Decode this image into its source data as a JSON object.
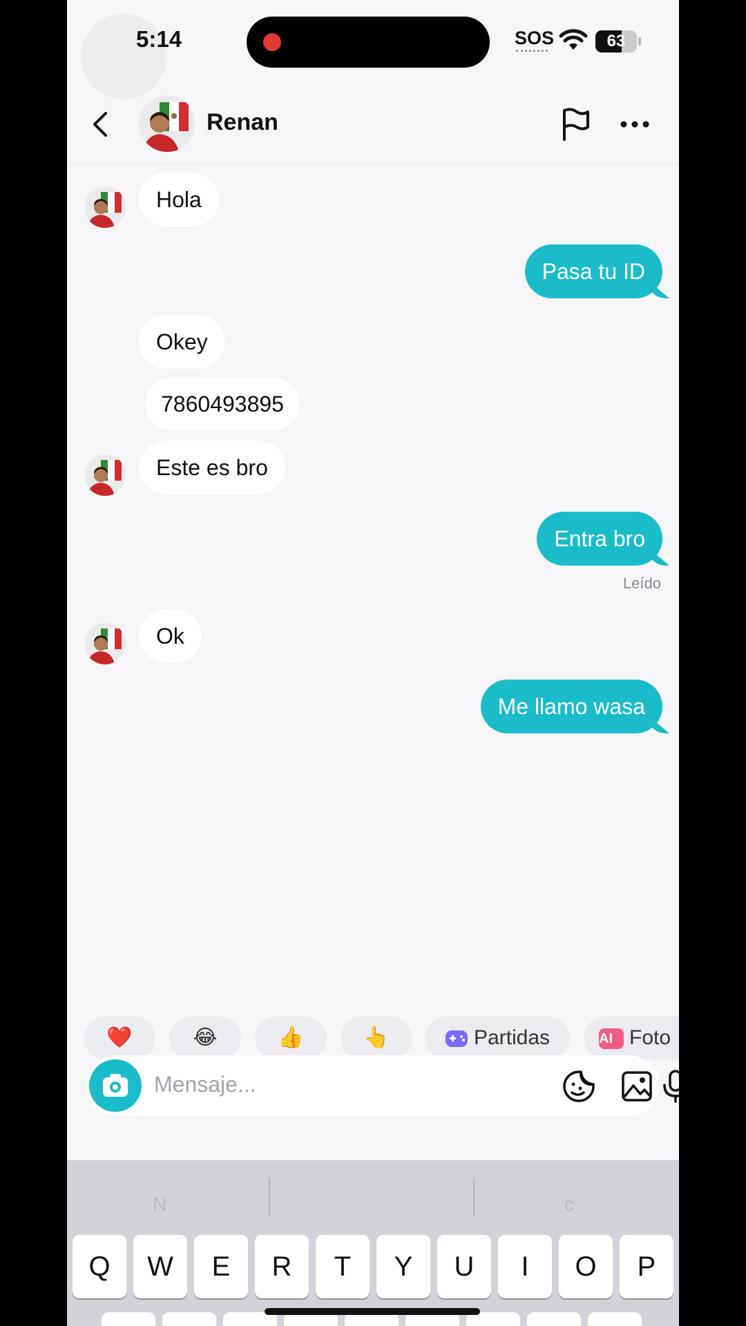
{
  "status": {
    "time": "5:14",
    "sos": "SOS",
    "battery": "63",
    "battery_level": 0.63
  },
  "header": {
    "contact_name": "Renan"
  },
  "messages": [
    {
      "from": "contact",
      "text": "Hola"
    },
    {
      "from": "me",
      "text": "Pasa tu ID"
    },
    {
      "from": "contact",
      "text": "Okey"
    },
    {
      "from": "contact",
      "text": "7860493895"
    },
    {
      "from": "contact",
      "text": "Este es bro"
    },
    {
      "from": "me",
      "text": "Entra bro"
    },
    {
      "from": "contact",
      "text": "Ok"
    },
    {
      "from": "me",
      "text": "Me llamo wasa"
    }
  ],
  "read_status": "Leído",
  "quick_replies": {
    "heart": "❤️",
    "laugh": "😂",
    "thumbs_up": "👍",
    "point": "👆",
    "games_label": "Partidas",
    "ai_badge": "AI",
    "photo_label": "Foto"
  },
  "composer": {
    "placeholder": "Mensaje..."
  },
  "keyboard": {
    "suggestion_1": "N",
    "suggestion_3": "c",
    "row1": [
      "Q",
      "W",
      "E",
      "R",
      "T",
      "Y",
      "U",
      "I",
      "O",
      "P"
    ]
  },
  "colors": {
    "accent": "#1bbcc9",
    "background": "#f6f5f8"
  }
}
